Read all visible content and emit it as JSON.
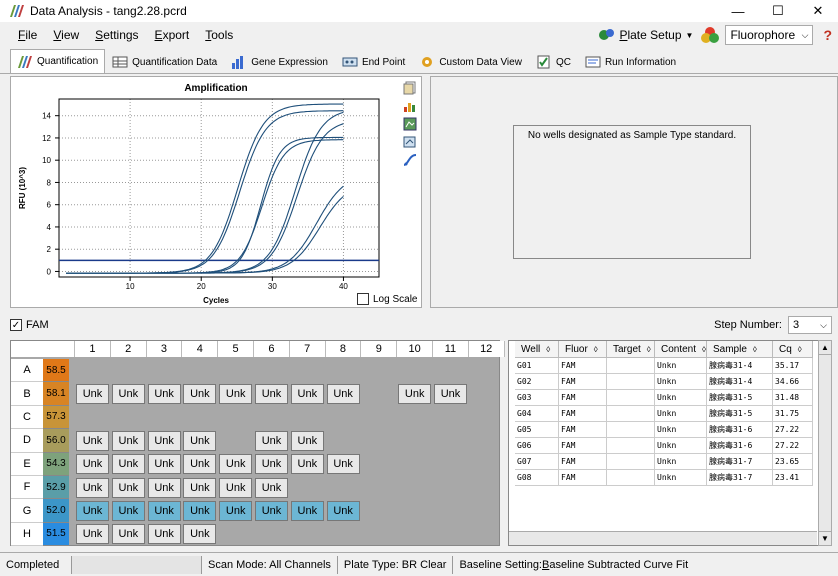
{
  "window": {
    "title": "Data Analysis - tang2.28.pcrd",
    "minimize": "—",
    "maximize": "☐",
    "close": "✕"
  },
  "menu": [
    {
      "key": "F",
      "rest": "ile"
    },
    {
      "key": "V",
      "rest": "iew"
    },
    {
      "key": "S",
      "rest": "ettings"
    },
    {
      "key": "E",
      "rest": "xport"
    },
    {
      "key": "T",
      "rest": "ools"
    }
  ],
  "toolbar": {
    "plate_setup": "Plate Setup",
    "plate_setup_key": "P",
    "plate_setup_rest": "late Setup",
    "fluorophore": "Fluorophore",
    "help": "?"
  },
  "tabs": [
    {
      "label": "Quantification",
      "icon": "amplification-icon",
      "active": true
    },
    {
      "label": "Quantification Data",
      "icon": "table-icon"
    },
    {
      "label": "Gene Expression",
      "icon": "bar-chart-icon"
    },
    {
      "label": "End Point",
      "icon": "endpoint-icon"
    },
    {
      "label": "Custom Data View",
      "icon": "gear-icon"
    },
    {
      "label": "QC",
      "icon": "qc-icon"
    },
    {
      "label": "Run Information",
      "icon": "info-icon"
    }
  ],
  "chart_data": {
    "type": "line",
    "title": "Amplification",
    "xlabel": "Cycles",
    "ylabel": "RFU (10^3)",
    "xlim": [
      0,
      45
    ],
    "ylim": [
      -0.5,
      15.5
    ],
    "xticks": [
      10,
      20,
      30,
      40
    ],
    "yticks": [
      0,
      2,
      4,
      6,
      8,
      10,
      12,
      14
    ],
    "threshold": 1.0,
    "log_scale_label": "Log Scale",
    "series": [
      {
        "ct": 23.4,
        "plateau": 15.2,
        "k": 0.55
      },
      {
        "ct": 23.7,
        "plateau": 14.6,
        "k": 0.55
      },
      {
        "ct": 27.2,
        "plateau": 12.2,
        "k": 0.75
      },
      {
        "ct": 27.2,
        "plateau": 12.0,
        "k": 0.65
      },
      {
        "ct": 31.5,
        "plateau": 14.8,
        "k": 0.55
      },
      {
        "ct": 31.8,
        "plateau": 13.8,
        "k": 0.55
      },
      {
        "ct": 34.7,
        "plateau": 9.0,
        "k": 0.5
      },
      {
        "ct": 35.2,
        "plateau": 8.2,
        "k": 0.5
      }
    ]
  },
  "no_standard": "No wells designated as Sample Type standard.",
  "fluor_filter": {
    "label": "FAM",
    "checked": "✓"
  },
  "step": {
    "label": "Step Number:",
    "value": "3"
  },
  "plate": {
    "columns": [
      "1",
      "2",
      "3",
      "4",
      "5",
      "6",
      "7",
      "8",
      "9",
      "10",
      "11",
      "12"
    ],
    "rows": [
      {
        "label": "A",
        "temp": "58.5",
        "color": "#e07818",
        "wells": [
          "",
          "",
          "",
          "",
          "",
          "",
          "",
          "",
          "",
          "",
          "",
          ""
        ]
      },
      {
        "label": "B",
        "temp": "58.1",
        "color": "#d88424",
        "wells": [
          "Unk",
          "Unk",
          "Unk",
          "Unk",
          "Unk",
          "Unk",
          "Unk",
          "Unk",
          "",
          "Unk",
          "Unk",
          ""
        ]
      },
      {
        "label": "C",
        "temp": "57.3",
        "color": "#c89438",
        "wells": [
          "",
          "",
          "",
          "",
          "",
          "",
          "",
          "",
          "",
          "",
          "",
          ""
        ]
      },
      {
        "label": "D",
        "temp": "56.0",
        "color": "#a89c5c",
        "wells": [
          "Unk",
          "Unk",
          "Unk",
          "Unk",
          "",
          "Unk",
          "Unk",
          "",
          "",
          "",
          "",
          ""
        ]
      },
      {
        "label": "E",
        "temp": "54.3",
        "color": "#7ea27c",
        "wells": [
          "Unk",
          "Unk",
          "Unk",
          "Unk",
          "Unk",
          "Unk",
          "Unk",
          "Unk",
          "",
          "",
          "",
          ""
        ]
      },
      {
        "label": "F",
        "temp": "52.9",
        "color": "#5a9ea8",
        "wells": [
          "Unk",
          "Unk",
          "Unk",
          "Unk",
          "Unk",
          "Unk",
          "",
          "",
          "",
          "",
          "",
          ""
        ]
      },
      {
        "label": "G",
        "temp": "52.0",
        "color": "#3c96c8",
        "wells": [
          "Unk",
          "Unk",
          "Unk",
          "Unk",
          "Unk",
          "Unk",
          "Unk",
          "Unk",
          "",
          "",
          "",
          ""
        ],
        "selected": [
          true,
          true,
          true,
          true,
          true,
          true,
          true,
          true,
          false,
          false,
          false,
          false
        ]
      },
      {
        "label": "H",
        "temp": "51.5",
        "color": "#2a8ce0",
        "wells": [
          "Unk",
          "Unk",
          "Unk",
          "Unk",
          "",
          "",
          "",
          "",
          "",
          "",
          "",
          ""
        ]
      }
    ]
  },
  "table": {
    "headers": [
      "Well",
      "Fluor",
      "Target",
      "Content",
      "Sample",
      "Cq"
    ],
    "rows": [
      [
        "G01",
        "FAM",
        "",
        "Unkn",
        "腺病毒31-4",
        "35.17"
      ],
      [
        "G02",
        "FAM",
        "",
        "Unkn",
        "腺病毒31-4",
        "34.66"
      ],
      [
        "G03",
        "FAM",
        "",
        "Unkn",
        "腺病毒31-5",
        "31.48"
      ],
      [
        "G04",
        "FAM",
        "",
        "Unkn",
        "腺病毒31-5",
        "31.75"
      ],
      [
        "G05",
        "FAM",
        "",
        "Unkn",
        "腺病毒31-6",
        "27.22"
      ],
      [
        "G06",
        "FAM",
        "",
        "Unkn",
        "腺病毒31-6",
        "27.22"
      ],
      [
        "G07",
        "FAM",
        "",
        "Unkn",
        "腺病毒31-7",
        "23.65"
      ],
      [
        "G08",
        "FAM",
        "",
        "Unkn",
        "腺病毒31-7",
        "23.41"
      ]
    ]
  },
  "status": {
    "state": "Completed",
    "scan": "Scan Mode: All Channels",
    "plate": "Plate Type: BR Clear",
    "baseline_prefix": "Baseline Setting: ",
    "baseline_key": "B",
    "baseline_rest": "aseline Subtracted Curve Fit"
  }
}
